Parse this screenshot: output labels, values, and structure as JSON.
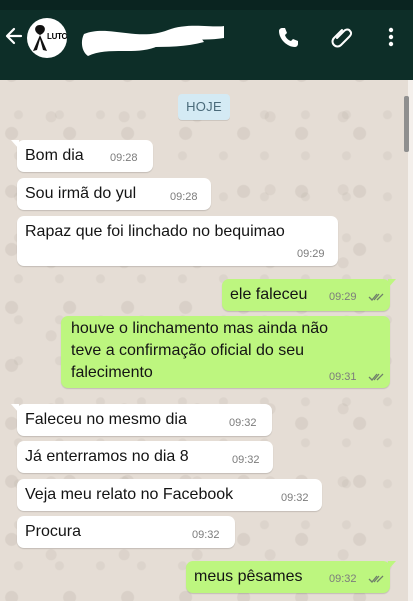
{
  "header": {
    "avatar_text": "LUTO",
    "contact_name": "",
    "icons": [
      "back-arrow-icon",
      "phone-icon",
      "paperclip-icon",
      "more-vert-icon"
    ]
  },
  "date_chip": "HOJE",
  "messages": [
    {
      "dir": "in",
      "text": "Bom dia",
      "time": "09:28"
    },
    {
      "dir": "in",
      "text": "Sou irmã do yul",
      "time": "09:28"
    },
    {
      "dir": "in",
      "text": "Rapaz que foi linchado no bequimao",
      "time": "09:29"
    },
    {
      "dir": "out",
      "text": "ele faleceu",
      "time": "09:29",
      "status": "read"
    },
    {
      "dir": "out",
      "lines": [
        "houve o linchamento mas ainda não",
        "teve a confirmação oficial do seu",
        "falecimento"
      ],
      "time": "09:31",
      "status": "read"
    },
    {
      "dir": "in",
      "text": "Faleceu no mesmo dia",
      "time": "09:32"
    },
    {
      "dir": "in",
      "text": "Já enterramos no dia 8",
      "time": "09:32"
    },
    {
      "dir": "in",
      "text": "Veja meu relato no Facebook",
      "time": "09:32"
    },
    {
      "dir": "in",
      "text": "Procura",
      "time": "09:32"
    },
    {
      "dir": "out",
      "text": "meus pêsames",
      "time": "09:32",
      "status": "read"
    }
  ],
  "colors": {
    "header": "#0d2e28",
    "incoming": "#ffffff",
    "outgoing": "#bdf67f",
    "date_chip": "#d4eaf4",
    "tick": "#6f7f6a"
  }
}
